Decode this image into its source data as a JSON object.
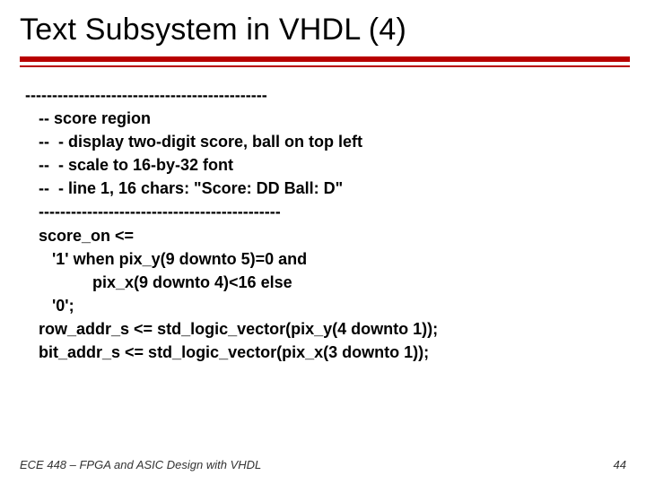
{
  "title": "Text Subsystem in VHDL (4)",
  "code": {
    "l0": "---------------------------------------------",
    "l1": "   -- score region",
    "l2": "   --  - display two-digit score, ball on top left",
    "l3": "   --  - scale to 16-by-32 font",
    "l4": "   --  - line 1, 16 chars: \"Score: DD Ball: D\"",
    "l5": "   ---------------------------------------------",
    "l6": "   score_on <=",
    "l7": "      '1' when pix_y(9 downto 5)=0 and",
    "l8": "               pix_x(9 downto 4)<16 else",
    "l9": "      '0';",
    "l10": "   row_addr_s <= std_logic_vector(pix_y(4 downto 1));",
    "l11": "   bit_addr_s <= std_logic_vector(pix_x(3 downto 1));"
  },
  "footer": {
    "left": "ECE 448 – FPGA and ASIC Design with VHDL",
    "right": "44"
  }
}
